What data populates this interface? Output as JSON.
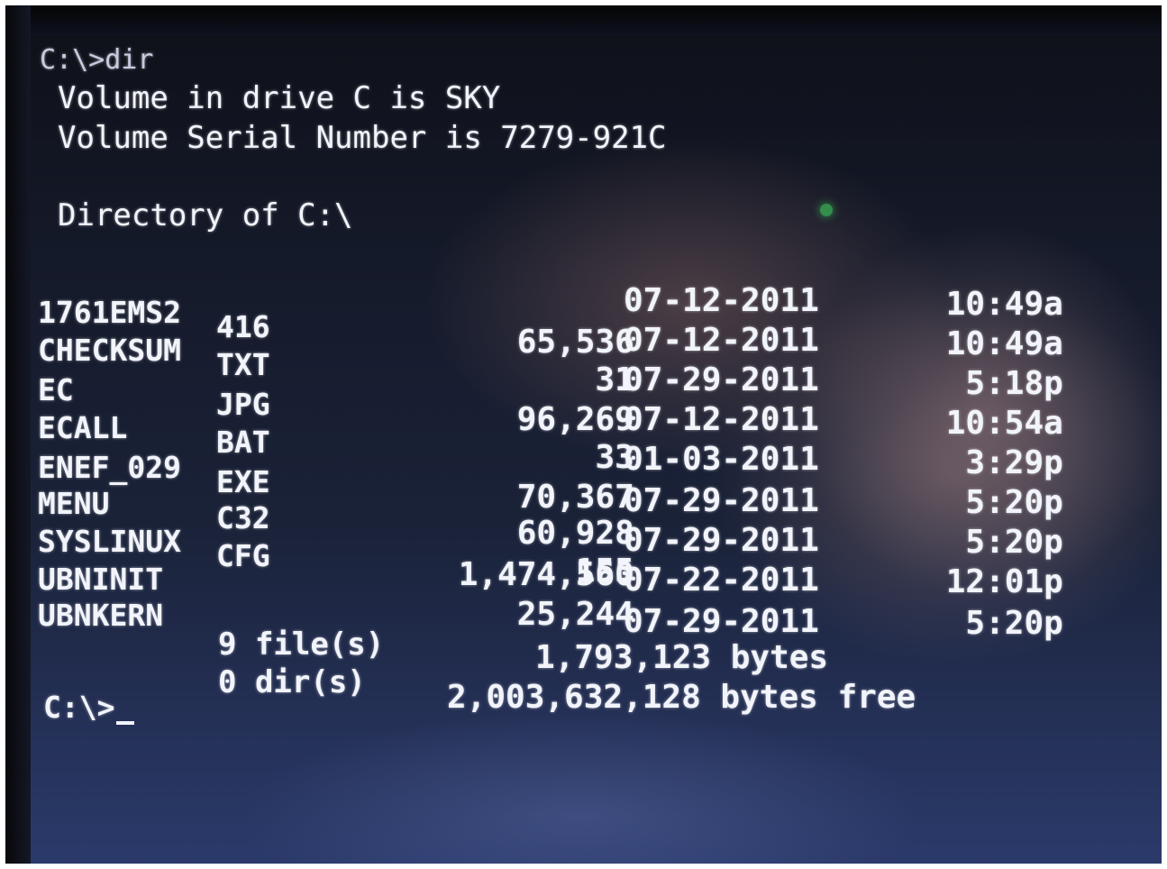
{
  "screen": {
    "command_line": "C:\\>dir",
    "volume_label_line": "Volume in drive C is SKY",
    "serial_line": "Volume Serial Number is 7279-921C",
    "directory_line": "Directory of C:\\",
    "files": [
      {
        "name": "1761EMS2",
        "ext": "416",
        "size": "65,536",
        "date": "07-12-2011",
        "time": "10:49a"
      },
      {
        "name": "CHECKSUM",
        "ext": "TXT",
        "size": "31",
        "date": "07-12-2011",
        "time": "10:49a"
      },
      {
        "name": "EC",
        "ext": "JPG",
        "size": "96,269",
        "date": "07-29-2011",
        "time": "5:18p"
      },
      {
        "name": "ECALL",
        "ext": "BAT",
        "size": "33",
        "date": "07-12-2011",
        "time": "10:54a"
      },
      {
        "name": "ENEF_029",
        "ext": "EXE",
        "size": "70,367",
        "date": "01-03-2011",
        "time": "3:29p"
      },
      {
        "name": "MENU",
        "ext": "C32",
        "size": "60,928",
        "date": "07-29-2011",
        "time": "5:20p"
      },
      {
        "name": "SYSLINUX",
        "ext": "CFG",
        "size": "155",
        "date": "07-29-2011",
        "time": "5:20p"
      },
      {
        "name": "UBNINIT",
        "ext": "",
        "size": "1,474,560",
        "date": "07-22-2011",
        "time": "12:01p"
      },
      {
        "name": "UBNKERN",
        "ext": "",
        "size": "25,244",
        "date": "07-29-2011",
        "time": "5:20p"
      }
    ],
    "summary_files_count": "9 file(s)",
    "summary_files_bytes": "1,793,123 bytes",
    "summary_dirs_count": "0 dir(s)",
    "summary_free_bytes": "2,003,632,128 bytes free",
    "prompt": "C:\\>"
  }
}
